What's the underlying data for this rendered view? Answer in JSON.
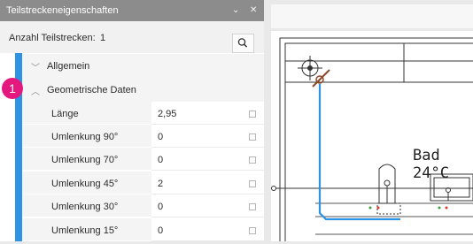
{
  "panel": {
    "title": "Teilstreckeneigenschaften",
    "pin_icon": "chevron-down-icon",
    "close_icon": "close-icon",
    "count_label": "Anzahl Teilstrecken:",
    "count_value": "1",
    "search_icon": "search-icon"
  },
  "groups": [
    {
      "label": "Allgemein",
      "state": "collapsed",
      "icon": "chevron-right-icon"
    },
    {
      "label": "Geometrische Daten",
      "state": "expanded",
      "icon": "chevron-down-icon"
    }
  ],
  "badge": {
    "number": "1",
    "color": "#e5187e"
  },
  "properties": [
    {
      "name": "Länge",
      "value": "2,95"
    },
    {
      "name": "Umlenkung 90°",
      "value": "0"
    },
    {
      "name": "Umlenkung 70°",
      "value": "0"
    },
    {
      "name": "Umlenkung 45°",
      "value": "2"
    },
    {
      "name": "Umlenkung 30°",
      "value": "0"
    },
    {
      "name": "Umlenkung 15°",
      "value": "0"
    }
  ],
  "drawing": {
    "room_label": "Bad 24°C",
    "pipe_color": "#2f93e5",
    "riser_color": "#8b4a2b"
  },
  "colors": {
    "title_bar": "#8c8c8c",
    "accent_strip": "#2f93e5",
    "badge": "#e5187e"
  }
}
